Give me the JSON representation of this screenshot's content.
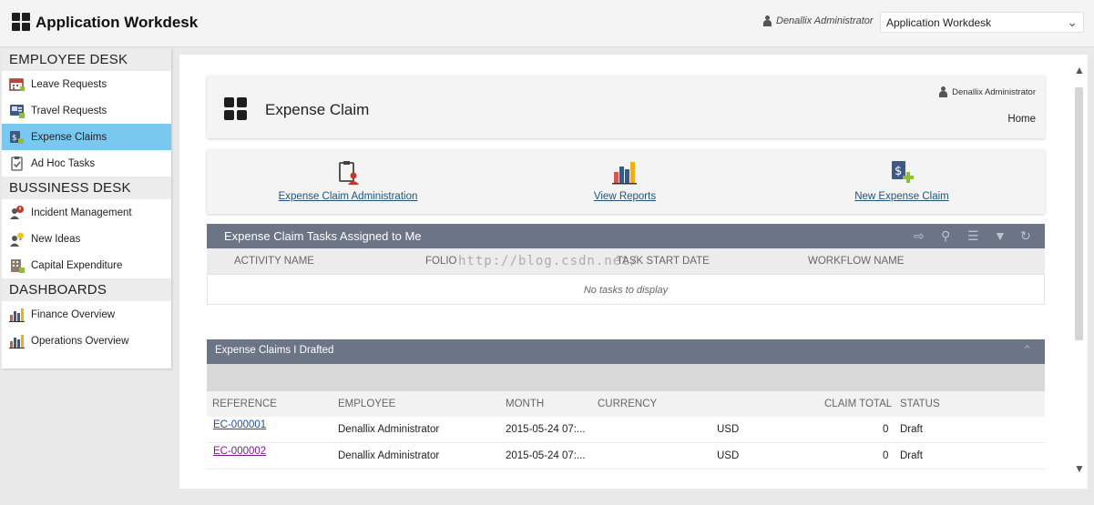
{
  "app": {
    "title": "Application Workdesk",
    "user": "Denallix Administrator",
    "selector_value": "Application Workdesk"
  },
  "sidebar": {
    "sections": [
      {
        "title": "EMPLOYEE DESK",
        "items": [
          {
            "label": "Leave Requests",
            "icon": "calendar-icon"
          },
          {
            "label": "Travel Requests",
            "icon": "travel-icon"
          },
          {
            "label": "Expense Claims",
            "icon": "expense-icon",
            "active": true
          },
          {
            "label": "Ad Hoc Tasks",
            "icon": "clipboard-check-icon"
          }
        ]
      },
      {
        "title": "BUSSINESS DESK",
        "items": [
          {
            "label": "Incident Management",
            "icon": "incident-icon"
          },
          {
            "label": "New Ideas",
            "icon": "idea-icon"
          },
          {
            "label": "Capital Expenditure",
            "icon": "building-icon"
          }
        ]
      },
      {
        "title": "DASHBOARDS",
        "items": [
          {
            "label": "Finance Overview",
            "icon": "bar-chart-icon"
          },
          {
            "label": "Operations Overview",
            "icon": "bar-chart-icon"
          }
        ]
      }
    ]
  },
  "page": {
    "title": "Expense Claim",
    "user": "Denallix Administrator",
    "home": "Home"
  },
  "actions": [
    {
      "label": "Expense Claim Administration",
      "icon": "claim-admin-icon"
    },
    {
      "label": "View Reports",
      "icon": "bar-chart-icon"
    },
    {
      "label": "New Expense Claim",
      "icon": "new-claim-icon"
    }
  ],
  "tasks": {
    "title": "Expense Claim Tasks Assigned to Me",
    "columns": [
      "ACTIVITY NAME",
      "FOLIO",
      "TASK START DATE",
      "WORKFLOW NAME"
    ],
    "empty": "No tasks to display",
    "watermark": "http://blog.csdn.net/"
  },
  "drafts": {
    "title": "Expense Claims I Drafted",
    "columns": [
      "REFERENCE",
      "EMPLOYEE",
      "MONTH",
      "CURRENCY",
      "CLAIM TOTAL",
      "STATUS"
    ],
    "rows": [
      {
        "reference": "EC-000001",
        "employee": "Denallix Administrator",
        "month": "2015-05-24 07:...",
        "currency": "USD",
        "total": "0",
        "status": "Draft"
      },
      {
        "reference": "EC-000002",
        "employee": "Denallix Administrator",
        "month": "2015-05-24 07:...",
        "currency": "USD",
        "total": "0",
        "status": "Draft"
      }
    ]
  },
  "colors": {
    "active_item": "#79c8ef",
    "grid_header": "#6b7586",
    "link": "#24537a"
  }
}
